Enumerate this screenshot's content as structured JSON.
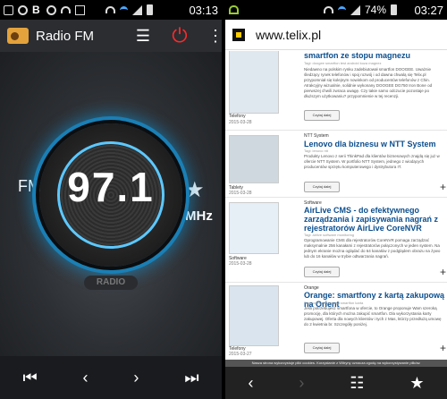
{
  "left_status": {
    "time": "03:13"
  },
  "radio": {
    "app_title": "Radio FM",
    "frequency": "97.1",
    "band_label": "FM",
    "unit_label": "MHz",
    "badge": "RADIO"
  },
  "right_status": {
    "battery": "74%",
    "time": "03:27"
  },
  "browser": {
    "url": "www.telix.pl",
    "articles": [
      {
        "thumb_label": "Telefony",
        "thumb_date": "2015-03-28",
        "category": "",
        "headline": "smartfon ze stopu magnezu",
        "meta": "Tagi: doogee smartfon test android koza magnez",
        "body": "Niedawno na polskim rynku zadebiutował smartfon DOOGEE. Uważnie śledzący rynek telefonów i spoj rozwój i od dawna chwalą się Telix.pl przypomniał się kolejnym nowinkom od producentów telefonów z Chin. Atrakcyjny wizualnie, solidnie wykonany DOOGEE DG750 Iron Bone od pierwszej chwili zwraca uwagę. Czy takie samo odczucie pozostaje po dłuższym użytkowaniu? przypomnienie w tej recenzji.",
        "readmore": "Czytaj dalej"
      },
      {
        "thumb_label": "Tablety",
        "thumb_date": "2015-03-28",
        "category": "NTT System",
        "headline": "Lenovo dla biznesu w NTT System",
        "meta": "Tagi: lenovo ntt",
        "body": "Produkty Lenovo z serii ThinkPad dla klientów biznesowych znajdą się już w ofercie NTT System. W portfolio NTT System, jednego z wiodących producentów sprzętu komputerowego i dystrybutora IT.",
        "readmore": "Czytaj dalej"
      },
      {
        "thumb_label": "Software",
        "thumb_date": "2015-03-28",
        "category": "Software",
        "headline": "AirLive CMS - do efektywnego zarządzania i zapisywania nagrań z rejestratorów AirLive CoreNVR",
        "meta": "Tagi: airlive software monitoring",
        "body": "Oprogramowanie CMS dla rejestratorów CoreNVR pomaga zarządzać maksymalnie 256 kanałami z rejestratorów połączonych w jeden system. Na jednym ekranie można oglądać do 64 kanałów z podglądem obrazu na żywo lub do 16 kanałów w trybie odtwarzania nagrań.",
        "readmore": "Czytaj dalej"
      },
      {
        "thumb_label": "Telefony",
        "thumb_date": "2015-03-27",
        "category": "Orange",
        "headline": "Orange: smartfony z kartą zakupową na Orient",
        "meta": "Tagi: orange promocja smartfon karta",
        "body": "Jeśli potrzebujesz smartfona w ofercie, to Orange proponuje Wam szeroką promocję, dla których można zakupić smartfon. Dla wykorzystania karty zakupowej. Oferta dla nowych klientów i tych z Mas, którzy przedłużą umowę do 2 kwietnia br. Szczegóły poniżej.",
        "readmore": "Czytaj dalej"
      }
    ],
    "cookie_notice": "Nasza strona wykorzystuje pliki cookies. Korzystanie z Witryny oznacza zgodę na wykorzystywanie plików."
  }
}
